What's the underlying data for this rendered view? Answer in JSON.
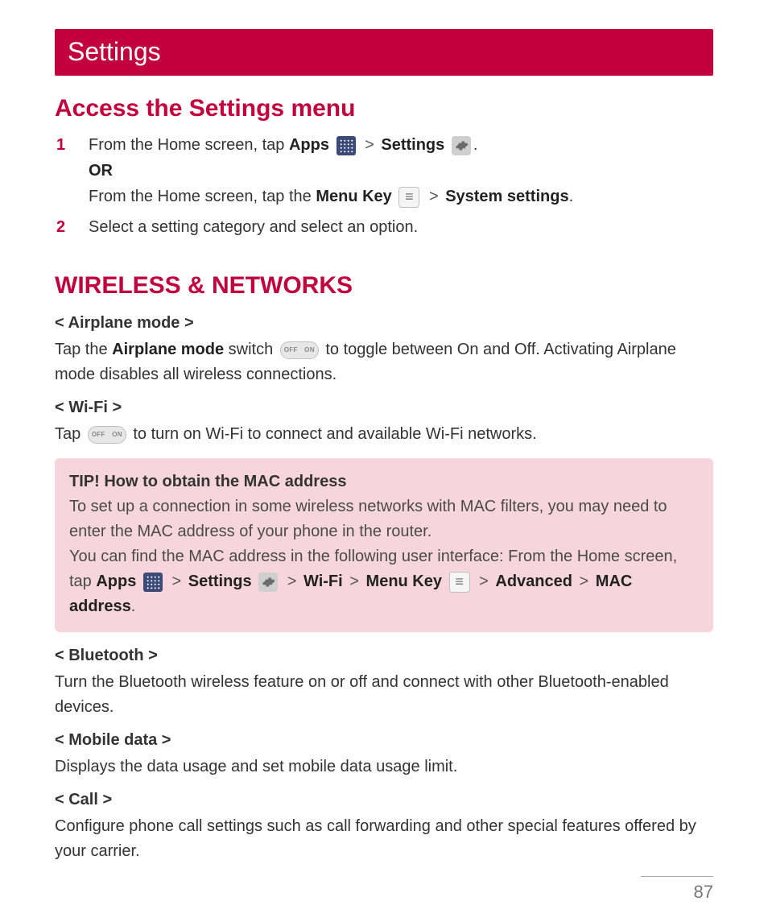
{
  "titleBar": "Settings",
  "accessSection": {
    "heading": "Access the Settings menu",
    "steps": {
      "s1": {
        "part1": "From the Home screen, tap ",
        "apps": "Apps",
        "sep1": " > ",
        "settings": "Settings",
        "tail": ".",
        "or": "OR",
        "part2a": "From the Home screen, tap the ",
        "menuKey": "Menu Key",
        "sep2": " > ",
        "sysSettings": "System settings",
        "tail2": "."
      },
      "s2": "Select a setting category and select an option."
    }
  },
  "wirelessSection": {
    "heading": "WIRELESS & NETWORKS",
    "airplane": {
      "title": "< Airplane mode >",
      "pre": "Tap the ",
      "bold": "Airplane mode",
      "mid": " switch ",
      "post": " to toggle between On and Off. Activating Airplane mode disables all wireless connections."
    },
    "wifi": {
      "title": "< Wi-Fi >",
      "pre": "Tap ",
      "post": " to turn on Wi-Fi to connect and available Wi-Fi networks."
    },
    "tip": {
      "title": "TIP! How to obtain the MAC address",
      "line1": "To set up a connection in some wireless networks with MAC filters, you may need to enter the MAC address of your phone in the router.",
      "line2a": "You can find the MAC address in the following user interface: From the Home screen, tap ",
      "apps": "Apps",
      "sep1": " > ",
      "settings": "Settings",
      "sep2": " > ",
      "wifi": "Wi-Fi",
      "sep3": " > ",
      "menuKey": "Menu Key",
      "sep4": " > ",
      "advanced": "Advanced",
      "sep5": " > ",
      "mac": "MAC address",
      "tail": "."
    },
    "bluetooth": {
      "title": "< Bluetooth >",
      "desc": "Turn the Bluetooth wireless feature on or off and connect with other Bluetooth-enabled devices."
    },
    "mobileData": {
      "title": "< Mobile data >",
      "desc": "Displays the data usage and set mobile data usage limit."
    },
    "call": {
      "title": "< Call >",
      "desc": "Configure phone call settings such as call forwarding and other special features offered by your carrier."
    }
  },
  "toggle": {
    "off": "OFF",
    "on": "ON"
  },
  "pageNumber": "87"
}
